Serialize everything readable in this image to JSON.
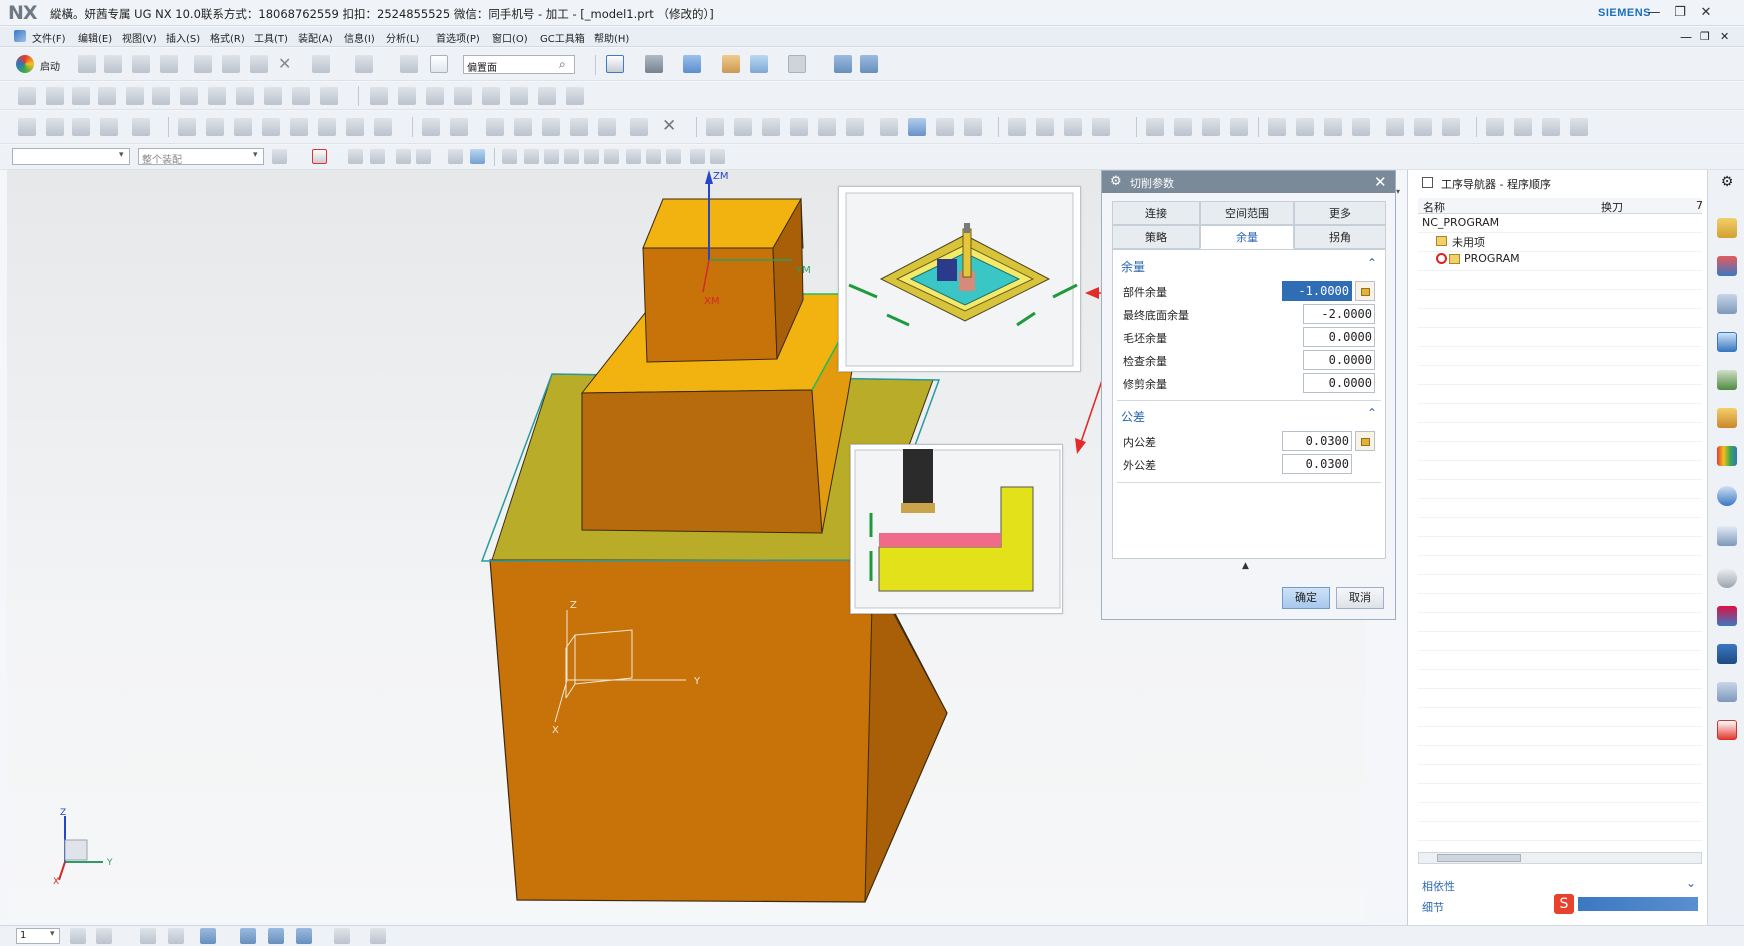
{
  "window": {
    "logo": "NX",
    "title": "縱橫。妍茜专属 UG NX 10.0联系方式：18068762559 扣扣：2524855525 微信：同手机号 - 加工 - [_model1.prt （修改的）]",
    "brand": "SIEMENS",
    "controls": [
      "—",
      "❐",
      "✕"
    ]
  },
  "menu": {
    "items": [
      "文件(F)",
      "编辑(E)",
      "视图(V)",
      "插入(S)",
      "格式(R)",
      "工具(T)",
      "装配(A)",
      "信息(I)",
      "分析(L)",
      "首选项(P)",
      "窗口(O)",
      "GC工具箱",
      "帮助(H)"
    ],
    "inner_controls": [
      "—",
      "❐",
      "✕"
    ]
  },
  "toolbar": {
    "start_label": "启动",
    "search_value": "偏置面",
    "selection_filter": "",
    "assembly_scope": "整个装配"
  },
  "viewport": {
    "colors": {
      "orange": "#c8720a",
      "yellow": "#f2b310",
      "olive": "#b9ac28",
      "cyan": "#2a9b9b"
    },
    "labels": {
      "zm": "ZM",
      "xm": "XM",
      "ym": "YM",
      "z": "Z",
      "y": "Y",
      "x": "X"
    }
  },
  "dialog": {
    "title": "切削参数",
    "tabs_row1": [
      "连接",
      "空间范围",
      "更多"
    ],
    "tabs_row2": [
      "策略",
      "余量",
      "拐角"
    ],
    "active_tab": "余量",
    "stock_section": {
      "header": "余量",
      "fields": [
        {
          "label": "部件余量",
          "value": "-1.0000"
        },
        {
          "label": "最终底面余量",
          "value": "-2.0000"
        },
        {
          "label": "毛坯余量",
          "value": "0.0000"
        },
        {
          "label": "检查余量",
          "value": "0.0000"
        },
        {
          "label": "修剪余量",
          "value": "0.0000"
        }
      ]
    },
    "tolerance_section": {
      "header": "公差",
      "fields": [
        {
          "label": "内公差",
          "value": "0.0300"
        },
        {
          "label": "外公差",
          "value": "0.0300"
        }
      ]
    },
    "ok_label": "确定",
    "cancel_label": "取消"
  },
  "navigator": {
    "title": "工序导航器 - 程序顺序",
    "columns": [
      "名称",
      "换刀",
      "7"
    ],
    "rows": [
      {
        "label": "NC_PROGRAM"
      },
      {
        "label": "未用项"
      },
      {
        "label": "PROGRAM"
      }
    ],
    "footer": [
      "相依性",
      "细节"
    ]
  },
  "statusbar": {
    "layer_value": "1"
  }
}
